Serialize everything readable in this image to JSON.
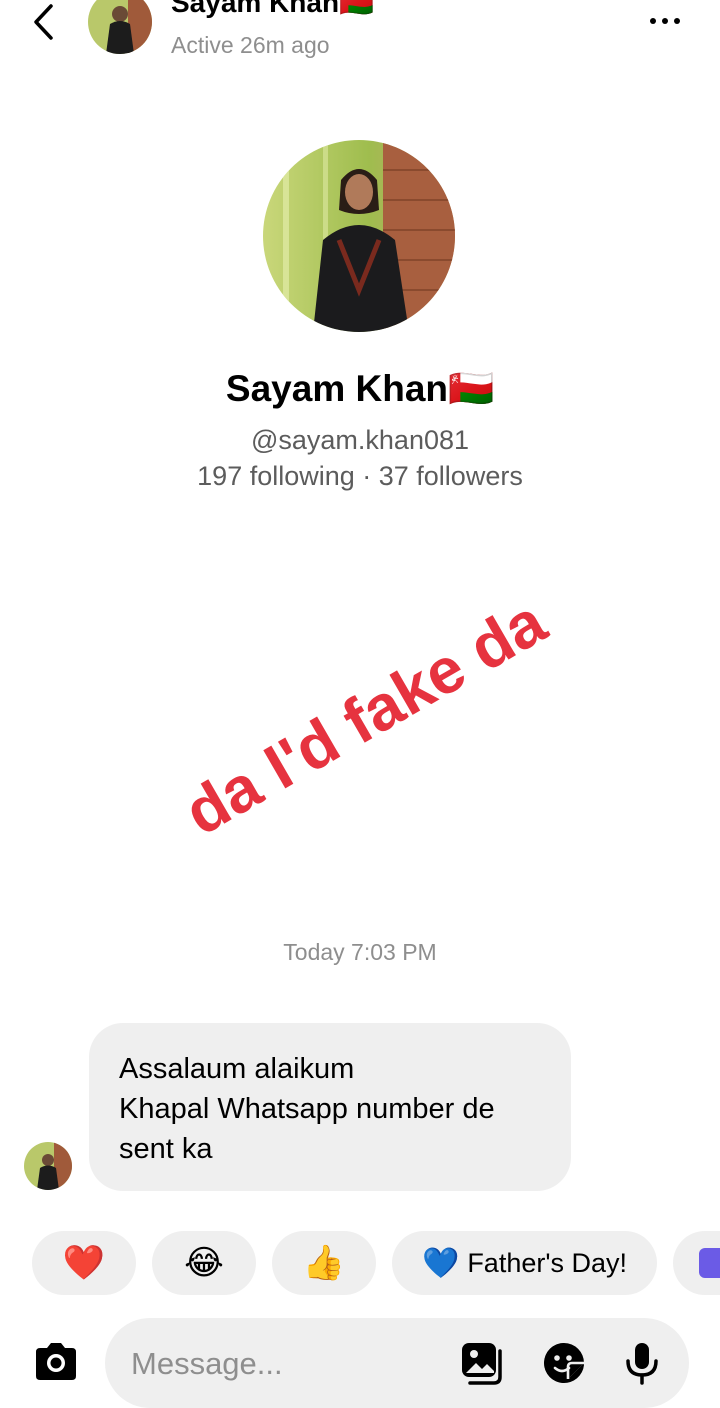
{
  "header": {
    "name": "Sayam Khan🇴🇲",
    "status": "Active 26m ago"
  },
  "profile": {
    "name": "Sayam Khan🇴🇲",
    "handle": "@sayam.khan081",
    "stats": "197 following · 37 followers"
  },
  "overlay_text": "da I'd fake da",
  "timestamp": "Today 7:03 PM",
  "message": {
    "lines": [
      "Assalaum alaikum",
      "Khapal Whatsapp number de",
      "sent ka"
    ]
  },
  "quick_reactions": {
    "heart": "❤️",
    "laugh": "😂",
    "thumbs": "👍",
    "fathers_day_emoji": "💙",
    "fathers_day_label": "Father's Day!"
  },
  "composer": {
    "placeholder": "Message..."
  },
  "colors": {
    "overlay": "#e6333f",
    "bubble": "#efefef",
    "muted": "#8e8e8e"
  }
}
